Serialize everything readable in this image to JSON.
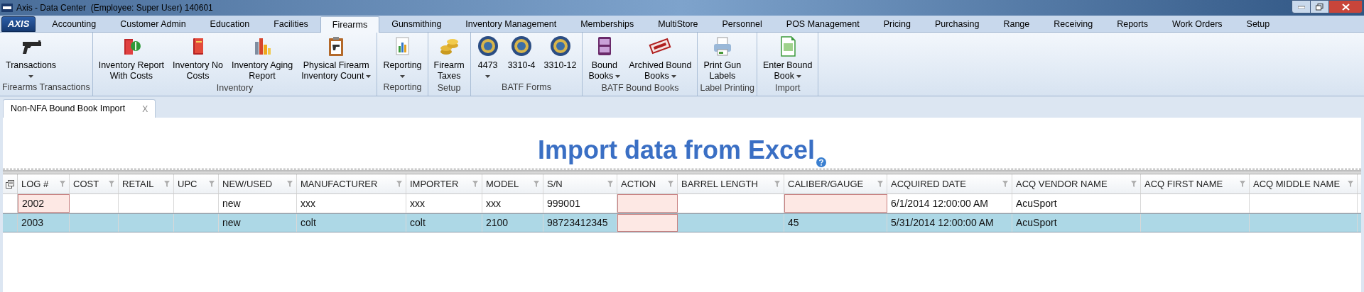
{
  "window": {
    "title": "Axis - Data Center  (Employee: Super User) 140601"
  },
  "app_button": {
    "label": "AXIS"
  },
  "tabs": [
    {
      "label": "Accounting",
      "selected": false
    },
    {
      "label": "Customer Admin",
      "selected": false
    },
    {
      "label": "Education",
      "selected": false
    },
    {
      "label": "Facilities",
      "selected": false
    },
    {
      "label": "Firearms",
      "selected": true
    },
    {
      "label": "Gunsmithing",
      "selected": false
    },
    {
      "label": "Inventory Management",
      "selected": false
    },
    {
      "label": "Memberships",
      "selected": false
    },
    {
      "label": "MultiStore",
      "selected": false
    },
    {
      "label": "Personnel",
      "selected": false
    },
    {
      "label": "POS Management",
      "selected": false
    },
    {
      "label": "Pricing",
      "selected": false
    },
    {
      "label": "Purchasing",
      "selected": false
    },
    {
      "label": "Range",
      "selected": false
    },
    {
      "label": "Receiving",
      "selected": false
    },
    {
      "label": "Reports",
      "selected": false
    },
    {
      "label": "Work Orders",
      "selected": false
    },
    {
      "label": "Setup",
      "selected": false
    }
  ],
  "ribbon_groups": [
    {
      "label": "Firearms Transactions",
      "items": [
        {
          "kind": "pistol",
          "lines": [
            "Transactions"
          ],
          "dropdown": true,
          "arrow_below": true
        }
      ]
    },
    {
      "label": "Inventory",
      "items": [
        {
          "kind": "money-book",
          "lines": [
            "Inventory Report",
            "With Costs"
          ],
          "dropdown": false
        },
        {
          "kind": "book",
          "lines": [
            "Inventory No",
            "Costs"
          ],
          "dropdown": false
        },
        {
          "kind": "bars",
          "lines": [
            "Inventory Aging",
            "Report"
          ],
          "dropdown": false
        },
        {
          "kind": "clipboard",
          "lines": [
            "Physical Firearm",
            "Inventory Count"
          ],
          "dropdown": true,
          "arrow_below": false
        }
      ]
    },
    {
      "label": "Reporting",
      "items": [
        {
          "kind": "report",
          "lines": [
            "Reporting"
          ],
          "dropdown": true,
          "arrow_below": true
        }
      ]
    },
    {
      "label": "Setup",
      "items": [
        {
          "kind": "coins",
          "lines": [
            "Firearm",
            "Taxes"
          ],
          "dropdown": false
        }
      ]
    },
    {
      "label": "BATF Forms",
      "items": [
        {
          "kind": "seal",
          "lines": [
            "4473"
          ],
          "dropdown": true,
          "arrow_below": true
        },
        {
          "kind": "seal",
          "lines": [
            "3310-4"
          ],
          "dropdown": false
        },
        {
          "kind": "seal",
          "lines": [
            "3310-12"
          ],
          "dropdown": false
        }
      ]
    },
    {
      "label": "BATF Bound Books",
      "items": [
        {
          "kind": "atf-book",
          "lines": [
            "Bound",
            "Books"
          ],
          "dropdown": true,
          "arrow_below": false
        },
        {
          "kind": "stamp",
          "lines": [
            "Archived Bound",
            "Books"
          ],
          "dropdown": true,
          "arrow_below": false
        }
      ]
    },
    {
      "label": "Label Printing",
      "items": [
        {
          "kind": "printer",
          "lines": [
            "Print Gun",
            "Labels"
          ],
          "dropdown": false
        }
      ]
    },
    {
      "label": "Import",
      "items": [
        {
          "kind": "sheet",
          "lines": [
            "Enter Bound",
            "Book"
          ],
          "dropdown": true,
          "arrow_below": false
        }
      ]
    }
  ],
  "document_tabs": [
    {
      "label": "Non-NFA Bound Book Import",
      "close": "X",
      "selected": true
    }
  ],
  "heading": "Import data from Excel",
  "table": {
    "columns": [
      {
        "label": "LOG #"
      },
      {
        "label": "COST"
      },
      {
        "label": "RETAIL"
      },
      {
        "label": "UPC"
      },
      {
        "label": "NEW/USED"
      },
      {
        "label": "MANUFACTURER"
      },
      {
        "label": "IMPORTER"
      },
      {
        "label": "MODEL"
      },
      {
        "label": "S/N"
      },
      {
        "label": "ACTION"
      },
      {
        "label": "BARREL LENGTH"
      },
      {
        "label": "CALIBER/GAUGE"
      },
      {
        "label": "ACQUIRED DATE"
      },
      {
        "label": "ACQ VENDOR NAME"
      },
      {
        "label": "ACQ FIRST NAME"
      },
      {
        "label": "ACQ MIDDLE NAME"
      }
    ],
    "rows": [
      {
        "selected": false,
        "cells": [
          {
            "text": "2002",
            "error": true
          },
          {
            "error": false
          },
          {
            "error": false
          },
          {
            "error": false
          },
          {
            "text": "new",
            "error": false
          },
          {
            "text": "xxx",
            "error": false
          },
          {
            "text": "xxx",
            "error": false
          },
          {
            "text": "xxx",
            "error": false
          },
          {
            "text": "999001",
            "error": false
          },
          {
            "error": true
          },
          {
            "error": false
          },
          {
            "error": true
          },
          {
            "text": "6/1/2014 12:00:00 AM",
            "error": false
          },
          {
            "text": "AcuSport",
            "error": false
          },
          {
            "error": false
          },
          {
            "error": false
          }
        ]
      },
      {
        "selected": true,
        "cells": [
          {
            "text": "2003",
            "error": false
          },
          {
            "error": false
          },
          {
            "error": false
          },
          {
            "error": false
          },
          {
            "text": "new",
            "error": false
          },
          {
            "text": "colt",
            "error": false
          },
          {
            "text": "colt",
            "error": false
          },
          {
            "text": "2100",
            "error": false
          },
          {
            "text": "98723412345",
            "error": false
          },
          {
            "error": true
          },
          {
            "error": false
          },
          {
            "text": "45",
            "error": false
          },
          {
            "text": "5/31/2014 12:00:00 AM",
            "error": false
          },
          {
            "text": "AcuSport",
            "error": false
          },
          {
            "error": false
          },
          {
            "error": false
          }
        ]
      }
    ]
  }
}
